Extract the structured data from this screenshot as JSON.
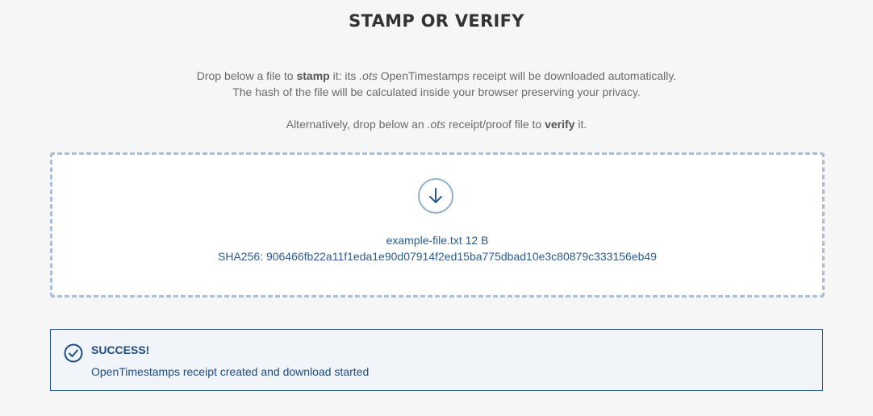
{
  "page": {
    "title": "STAMP OR VERIFY"
  },
  "intro": {
    "line1_a": "Drop below a file to ",
    "line1_b": "stamp",
    "line1_c": " it: its ",
    "line1_d": ".ots",
    "line1_e": " OpenTimestamps receipt will be downloaded automatically.",
    "line2": "The hash of the file will be calculated inside your browser preserving your privacy.",
    "line3_a": "Alternatively, drop below an ",
    "line3_b": ".ots",
    "line3_c": " receipt/proof file to ",
    "line3_d": "verify",
    "line3_e": " it."
  },
  "dropzone": {
    "icon": "download-arrow-icon",
    "file_name": "example-file.txt",
    "file_size": "12 B",
    "hash_label": "SHA256:",
    "hash_value": "906466fb22a11f1eda1e90d07914f2ed15ba775dbad10e3c80879c333156eb49"
  },
  "alert": {
    "icon": "check-circle-icon",
    "title": "SUCCESS!",
    "message": "OpenTimestamps receipt created and download started",
    "color": "#1d4c85"
  }
}
